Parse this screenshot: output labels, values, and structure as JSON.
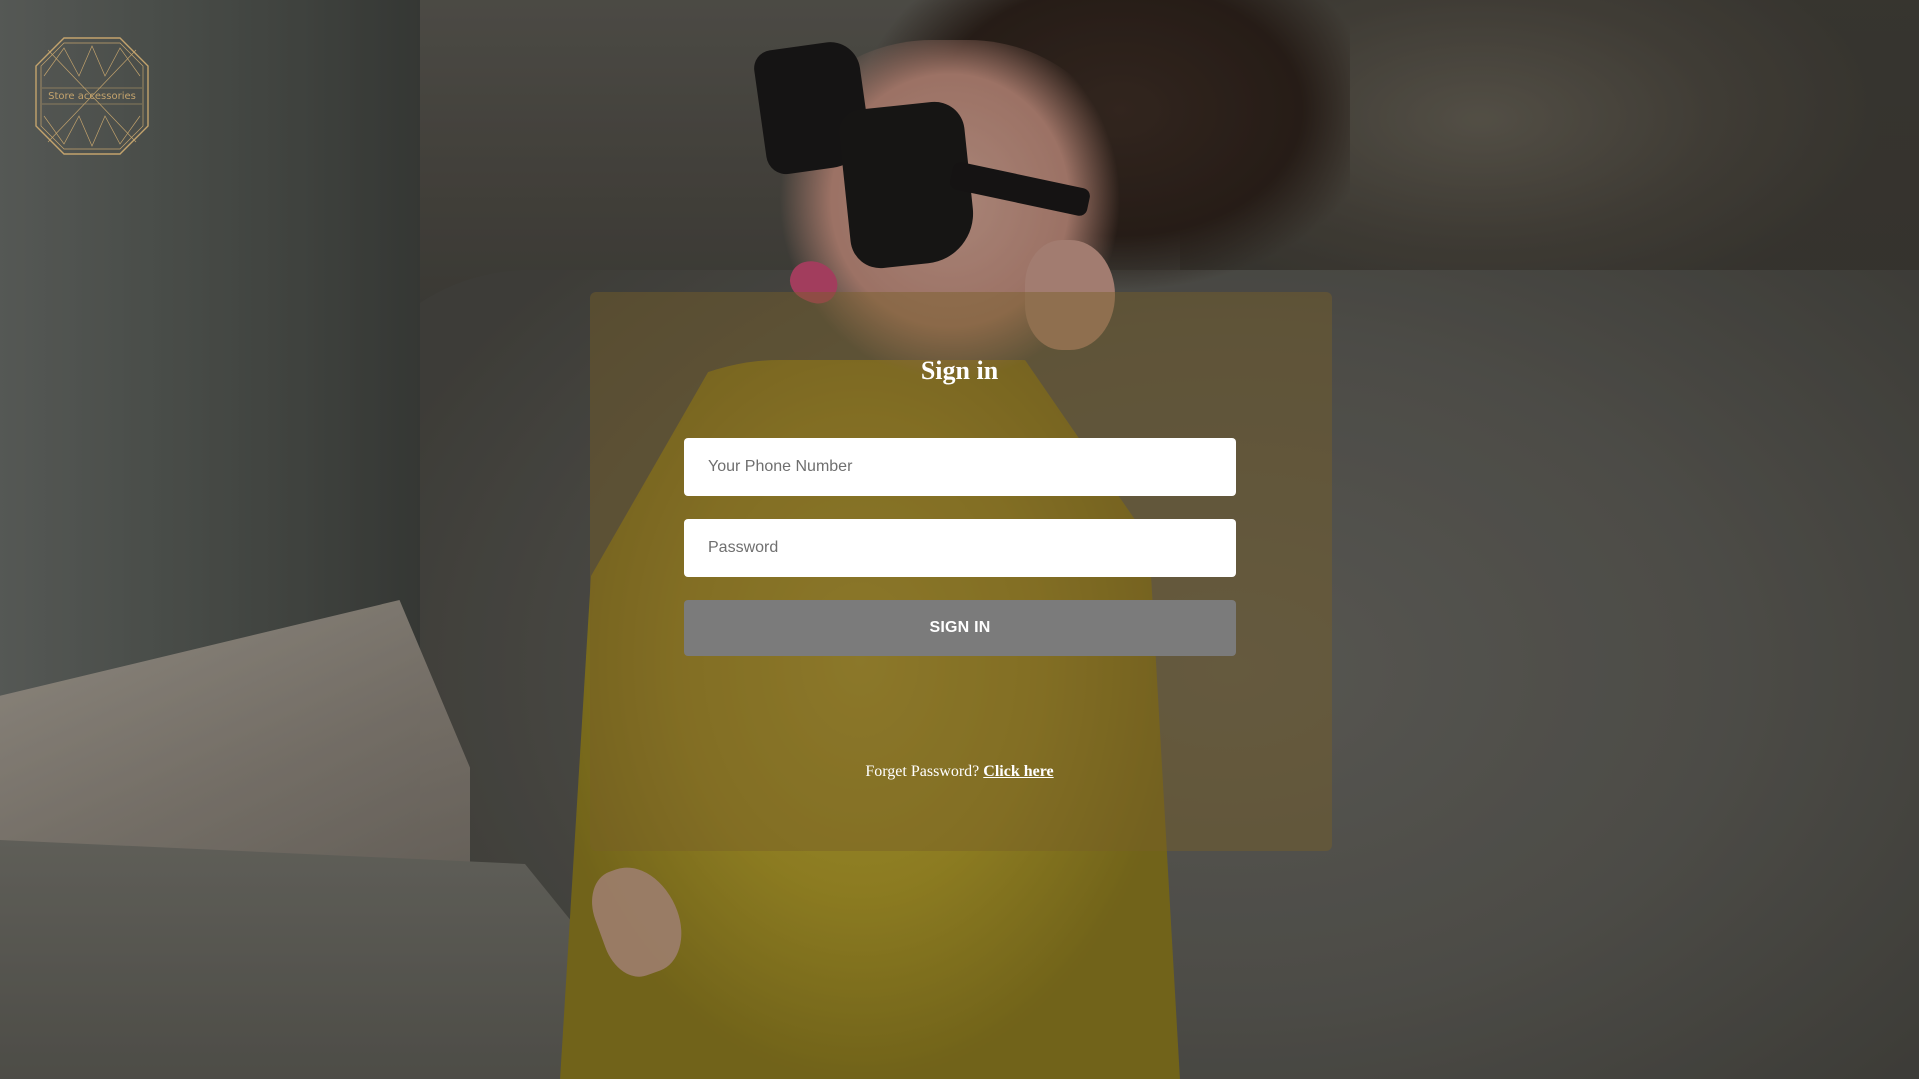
{
  "brand": {
    "logo_text": "Store accessories"
  },
  "login": {
    "title": "Sign in",
    "phone_placeholder": "Your Phone Number",
    "password_placeholder": "Password",
    "submit_label": "SIGN IN",
    "forgot_text": "Forget Password?",
    "forgot_link": "Click here"
  },
  "colors": {
    "panel": "#78602873",
    "button": "#7b7b7b",
    "logo_gold": "#c3a36d"
  }
}
